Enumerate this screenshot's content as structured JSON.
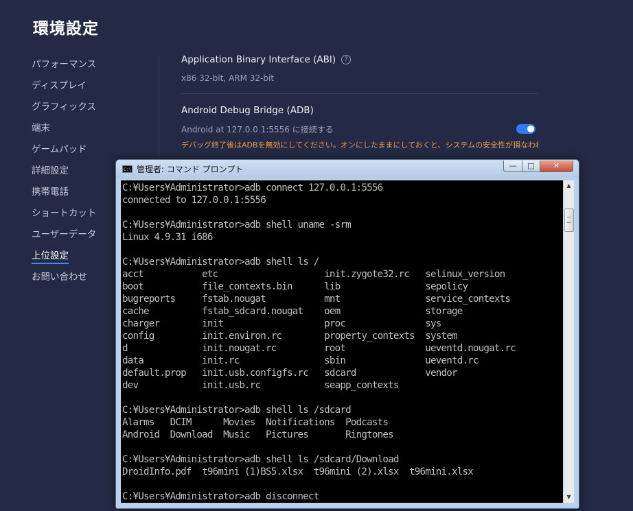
{
  "settings": {
    "title": "環境設定",
    "sidebar": {
      "items": [
        {
          "label": "パフォーマンス"
        },
        {
          "label": "ディスプレイ"
        },
        {
          "label": "グラフィックス"
        },
        {
          "label": "端末"
        },
        {
          "label": "ゲームパッド"
        },
        {
          "label": "詳細設定"
        },
        {
          "label": "携帯電話"
        },
        {
          "label": "ショートカット"
        },
        {
          "label": "ユーザーデータ"
        },
        {
          "label": "上位設定"
        },
        {
          "label": "お問い合わせ"
        }
      ],
      "active_label": "上位設定"
    },
    "abi": {
      "title": "Application Binary Interface (ABI)",
      "help_glyph": "?",
      "value": "x86 32-bit, ARM 32-bit"
    },
    "adb": {
      "title": "Android Debug Bridge (ADB)",
      "status": "Android at 127.0.0.1:5556 に接続する",
      "enabled": true,
      "warning": "デバッグ終了後はADBを無効にしてください。オンにしたままにしておくと、システムの安全性が損なわれる場合があ",
      "accent_color": "#2f7cf6",
      "warning_color": "#ec9a3e"
    }
  },
  "console": {
    "title": "管理者: コマンド プロンプト",
    "icon": "cmd-icon",
    "controls": {
      "minimize": "—",
      "maximize": "□",
      "close": "✕"
    },
    "lines": [
      "C:¥Users¥Administrator>adb connect 127.0.0.1:5556",
      "connected to 127.0.0.1:5556",
      "",
      "C:¥Users¥Administrator>adb shell uname -srm",
      "Linux 4.9.31 i686",
      "",
      "C:¥Users¥Administrator>adb shell ls /",
      "acct           etc                    init.zygote32.rc   selinux_version",
      "boot           file_contexts.bin      lib                sepolicy",
      "bugreports     fstab.nougat           mnt                service_contexts",
      "cache          fstab_sdcard.nougat    oem                storage",
      "charger        init                   proc               sys",
      "config         init.environ.rc        property_contexts  system",
      "d              init.nougat.rc         root               ueventd.nougat.rc",
      "data           init.rc                sbin               ueventd.rc",
      "default.prop   init.usb.configfs.rc   sdcard             vendor",
      "dev            init.usb.rc            seapp_contexts",
      "",
      "C:¥Users¥Administrator>adb shell ls /sdcard",
      "Alarms   DCIM      Movies  Notifications  Podcasts",
      "Android  Download  Music   Pictures       Ringtones",
      "",
      "C:¥Users¥Administrator>adb shell ls /sdcard/Download",
      "DroidInfo.pdf  t96mini (1)BS5.xlsx  t96mini (2).xlsx  t96mini.xlsx",
      "",
      "C:¥Users¥Administrator>adb disconnect"
    ],
    "scroll_position": 0.06
  }
}
